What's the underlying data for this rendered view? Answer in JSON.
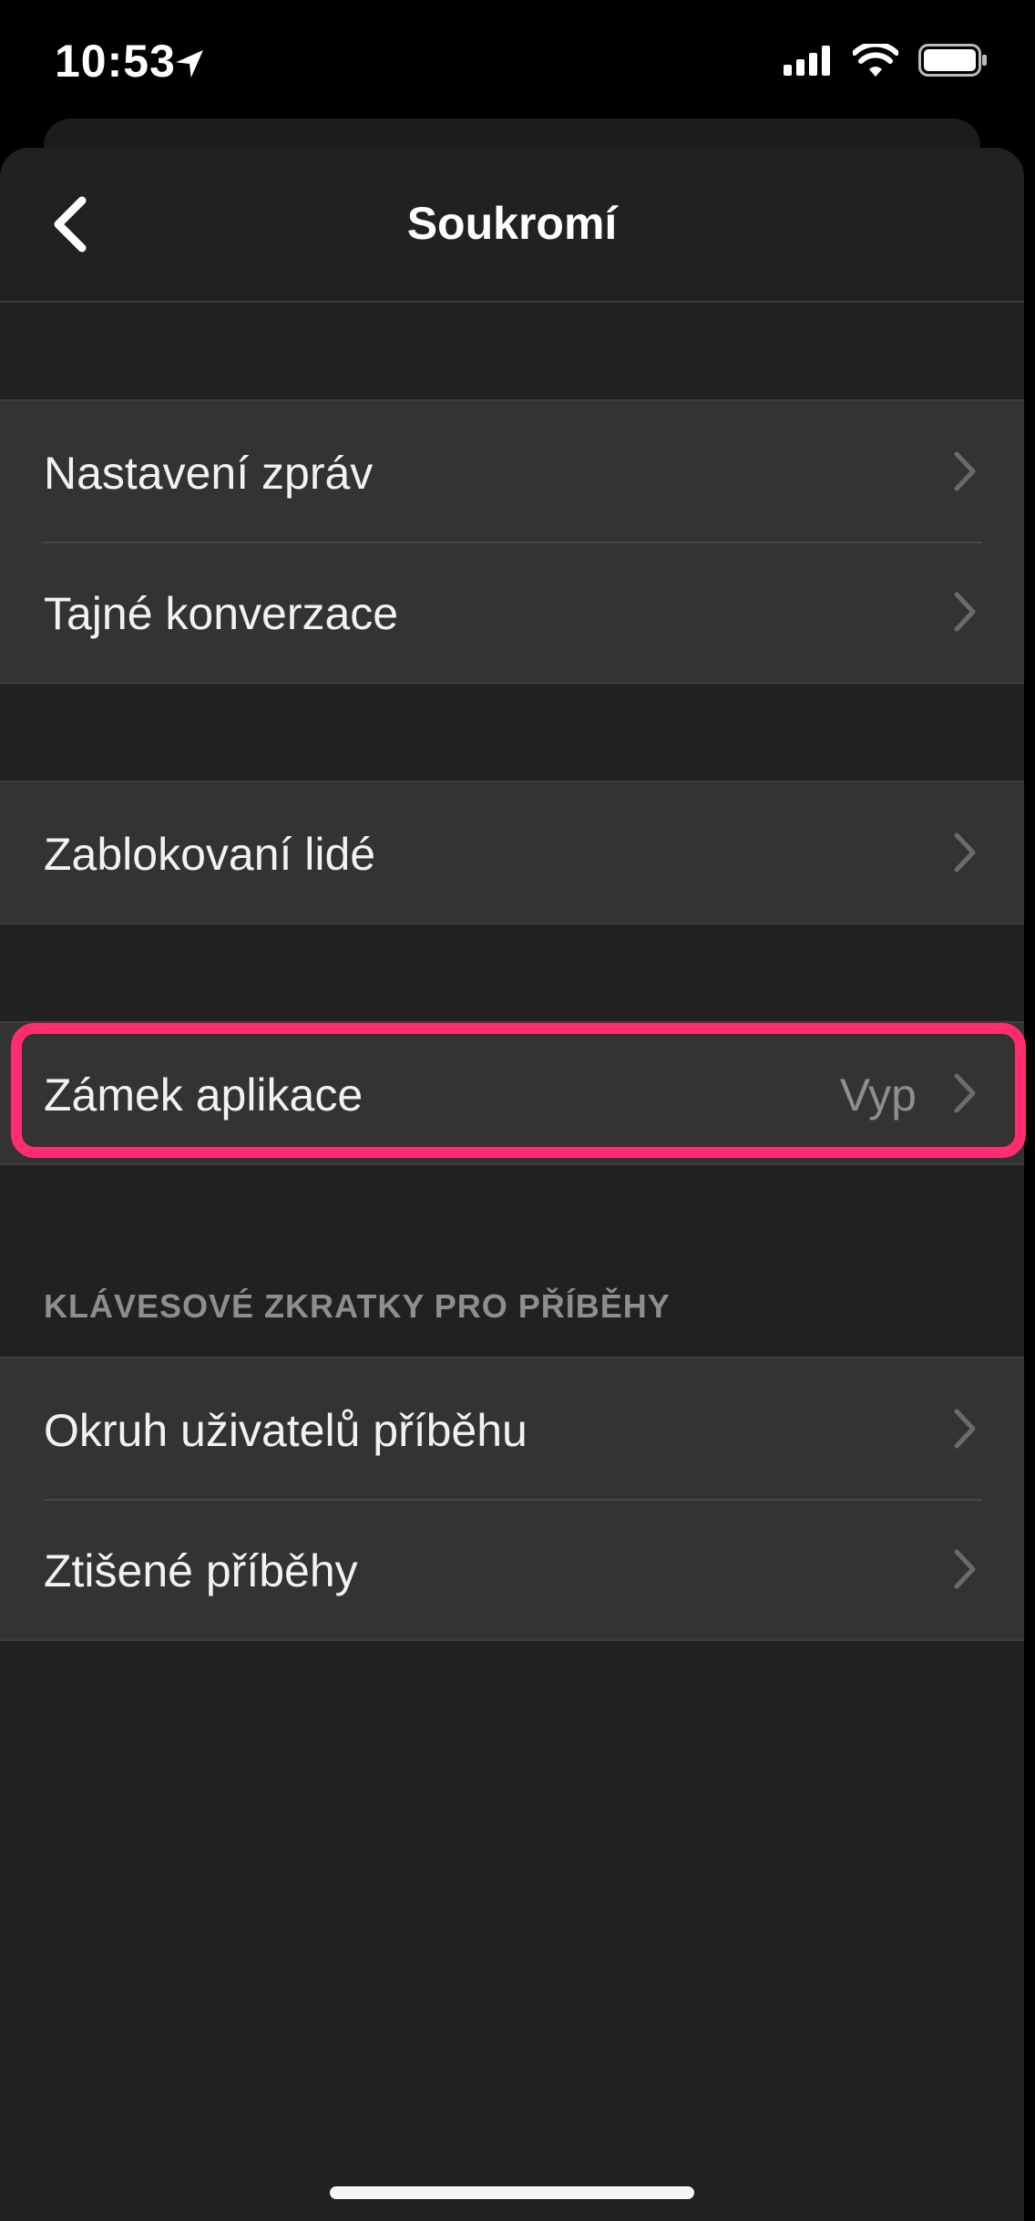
{
  "status": {
    "time": "10:53"
  },
  "nav": {
    "title": "Soukromí",
    "back_icon": "chevron-left-icon"
  },
  "groups": [
    {
      "items": [
        {
          "label": "Nastavení zpráv"
        },
        {
          "label": "Tajné konverzace"
        }
      ]
    },
    {
      "items": [
        {
          "label": "Zablokovaní lidé"
        }
      ]
    },
    {
      "items": [
        {
          "label": "Zámek aplikace",
          "value": "Vyp",
          "highlighted": true
        }
      ]
    },
    {
      "header": "KLÁVESOVÉ ZKRATKY PRO PŘÍBĚHY",
      "items": [
        {
          "label": "Okruh uživatelů příběhu"
        },
        {
          "label": "Ztišené příběhy"
        }
      ]
    }
  ],
  "colors": {
    "accent_highlight": "#ff2d6e",
    "background": "#212121",
    "cell": "#333333",
    "secondary_text": "#8e8e8e"
  }
}
